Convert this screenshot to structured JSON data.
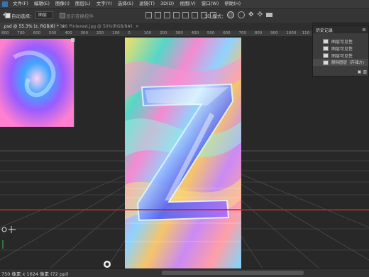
{
  "menu": {
    "items": [
      "文件(F)",
      "编辑(E)",
      "图像(I)",
      "图层(L)",
      "文字(Y)",
      "选择(S)",
      "滤镜(T)",
      "3D(D)",
      "视图(V)",
      "窗口(W)",
      "帮助(H)"
    ]
  },
  "options": {
    "auto_select_label": "自动选择：",
    "auto_select_value": "图层",
    "show_transform_label": "显示变换控件",
    "mode_label": "3D 模式："
  },
  "tabs": [
    {
      "label": ".psd @ 55.3% (z, RGB/8) *"
    },
    {
      "label": "326 Pinterest.jpg @ 50%(RGB/8#)"
    }
  ],
  "ruler": {
    "labels": [
      "800",
      "700",
      "600",
      "500",
      "400",
      "300",
      "200",
      "100",
      "0",
      "100",
      "200",
      "300",
      "400",
      "500",
      "600",
      "700",
      "800",
      "900",
      "1000",
      "110"
    ]
  },
  "history": {
    "title": "历史记录",
    "items": [
      "图层可见性",
      "图层可见性",
      "图层可见性",
      "删除图层（存储方)"
    ]
  },
  "status": {
    "text": "750 像素 x 1624 像素 (72 ppi)"
  },
  "canvas": {
    "letter": "Z"
  },
  "colors": {
    "menubar": "#3a3a3a",
    "panel": "#3c3c3c",
    "grid_line": "#5a5a5a",
    "horizon": "#d01818"
  }
}
